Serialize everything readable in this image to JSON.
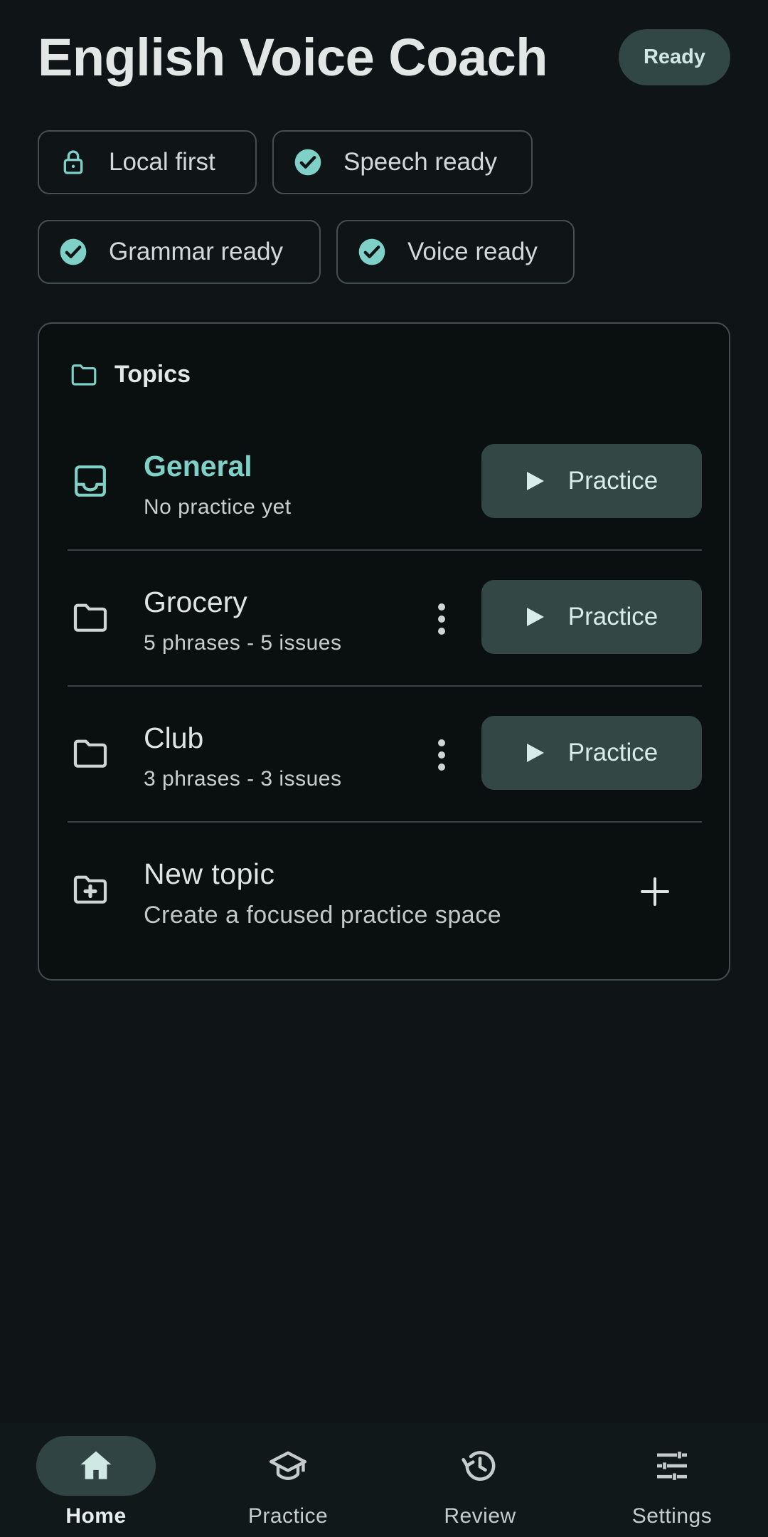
{
  "header": {
    "title": "English Voice Coach",
    "status_badge": "Ready"
  },
  "chips": [
    {
      "label": "Local first",
      "icon": "lock-icon"
    },
    {
      "label": "Speech ready",
      "icon": "check-circle-icon"
    },
    {
      "label": "Grammar ready",
      "icon": "check-circle-icon"
    },
    {
      "label": "Voice ready",
      "icon": "check-circle-icon"
    }
  ],
  "topics_card": {
    "title": "Topics",
    "icon": "folder-icon",
    "topics": [
      {
        "name": "General",
        "meta": "No practice yet",
        "icon": "inbox-icon",
        "action": "Practice"
      },
      {
        "name": "Grocery",
        "meta": "5 phrases - 5 issues",
        "icon": "folder-icon",
        "action": "Practice"
      },
      {
        "name": "Club",
        "meta": "3 phrases - 3 issues",
        "icon": "folder-icon",
        "action": "Practice"
      }
    ],
    "new_topic": {
      "name": "New topic",
      "meta": "Create a focused practice space",
      "icon": "folder-add-icon"
    }
  },
  "nav": {
    "items": [
      {
        "label": "Home",
        "icon": "home-icon",
        "active": true
      },
      {
        "label": "Practice",
        "icon": "graduation-cap-icon",
        "active": false
      },
      {
        "label": "Review",
        "icon": "history-icon",
        "active": false
      },
      {
        "label": "Settings",
        "icon": "sliders-icon",
        "active": false
      }
    ]
  },
  "colors": {
    "background": "#0f1516",
    "accent": "#7fd0c6",
    "button": "#334745",
    "card": "#0a0f10"
  }
}
